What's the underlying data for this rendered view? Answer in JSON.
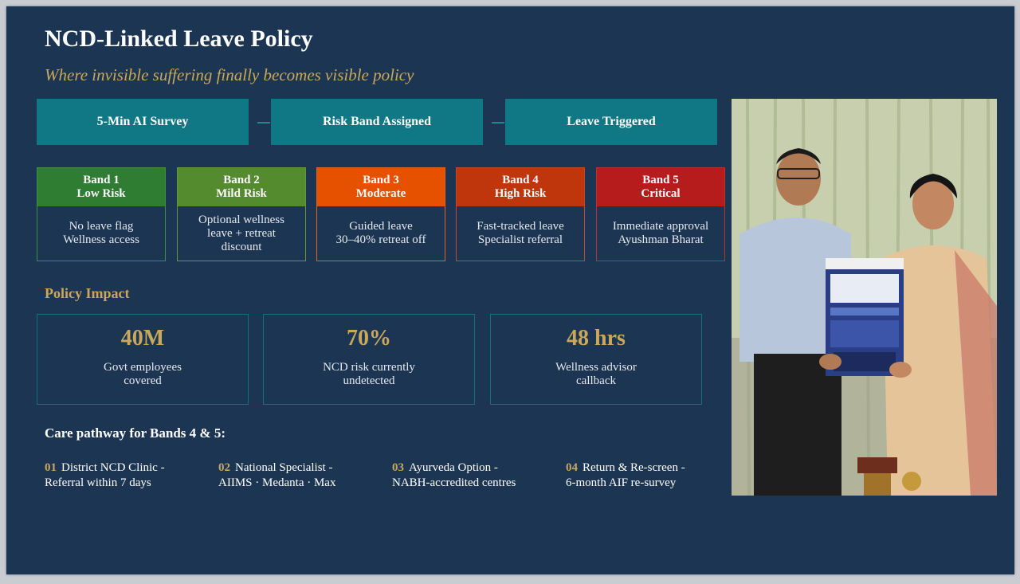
{
  "header": {
    "title": "NCD-Linked Leave Policy",
    "subtitle": "Where invisible suffering finally becomes visible policy"
  },
  "flow": [
    {
      "label": "5-Min AI Survey"
    },
    {
      "label": "Risk Band Assigned"
    },
    {
      "label": "Leave Triggered"
    }
  ],
  "bands": [
    {
      "title": "Band 1",
      "level": "Low Risk",
      "line1": "No leave flag",
      "line2": "Wellness access",
      "line3": "",
      "color": "#2e7d32",
      "border": "#3d8f46"
    },
    {
      "title": "Band 2",
      "level": "Mild Risk",
      "line1": "Optional wellness",
      "line2": "leave + retreat",
      "line3": "discount",
      "color": "#558b2f",
      "border": "#63983b"
    },
    {
      "title": "Band 3",
      "level": "Moderate",
      "line1": "Guided leave",
      "line2": "30–40% retreat off",
      "line3": "",
      "color": "#e65100",
      "border": "#e2631d"
    },
    {
      "title": "Band 4",
      "level": "High Risk",
      "line1": "Fast-tracked leave",
      "line2": "Specialist referral",
      "line3": "",
      "color": "#bf360c",
      "border": "#c4492a"
    },
    {
      "title": "Band 5",
      "level": "Critical",
      "line1": "Immediate approval",
      "line2": "Ayushman Bharat",
      "line3": "",
      "color": "#b71c1c",
      "border": "#b8332f"
    }
  ],
  "impact": {
    "title": "Policy Impact",
    "stats": [
      {
        "value": "40M",
        "line1": "Govt employees",
        "line2": "covered"
      },
      {
        "value": "70%",
        "line1": "NCD risk currently",
        "line2": "undetected"
      },
      {
        "value": "48 hrs",
        "line1": "Wellness advisor",
        "line2": "callback"
      }
    ]
  },
  "care": {
    "title": "Care pathway for Bands 4 & 5:",
    "steps": [
      {
        "num": "01",
        "line1": "District NCD Clinic -",
        "line2": "Referral within 7 days"
      },
      {
        "num": "02",
        "line1": "National Specialist -",
        "line2": "AIIMS · Medanta · Max"
      },
      {
        "num": "03",
        "line1": "Ayurveda Option -",
        "line2": "NABH-accredited centres"
      },
      {
        "num": "04",
        "line1": "Return & Re-screen -",
        "line2": "6-month AIF re-survey"
      }
    ]
  },
  "colors": {
    "background": "#1c3552",
    "accent_gold": "#c9a85c",
    "teal": "#0f7884"
  }
}
